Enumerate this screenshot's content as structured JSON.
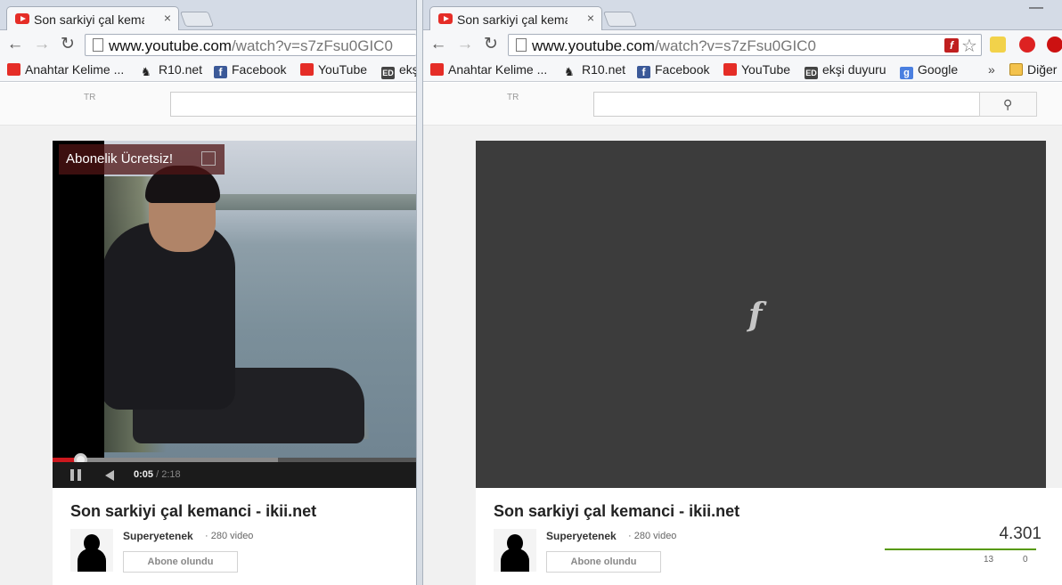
{
  "tab": {
    "title": "Son sarkiyi çal keman",
    "close": "×"
  },
  "window_controls": {
    "minimize": "—"
  },
  "address": {
    "host": "www.youtube.com",
    "path": "/watch?v=s7zFsu0GIC0"
  },
  "nav": {
    "back": "←",
    "forward": "→",
    "reload": "↻"
  },
  "bookmarks": [
    {
      "label": "Anahtar Kelime ...",
      "icon": "youtube-icon"
    },
    {
      "label": "R10.net",
      "icon": "r10-icon"
    },
    {
      "label": "Facebook",
      "icon": "facebook-icon"
    },
    {
      "label": "YouTube",
      "icon": "youtube-icon"
    },
    {
      "label": "ekşi duyuru",
      "icon": "eksi-icon"
    },
    {
      "label": "Google",
      "icon": "google-icon"
    }
  ],
  "bookmarks_left_truncated": "ekşi",
  "bookmarks_more": "»",
  "bookmarks_other": "Diğer",
  "youtube": {
    "country": "TR",
    "search_icon": "⚲"
  },
  "player_left": {
    "ad_text": "Abonelik Ücretsiz!",
    "time_current": "0:05",
    "time_sep": " / ",
    "time_total": "2:18",
    "progress_played": 0.075,
    "progress_buffered": 0.62
  },
  "player_right": {
    "flash_glyph": "f"
  },
  "video": {
    "title": "Son sarkiyi çal kemanci - ikii.net",
    "channel": "Superyetenek",
    "channel_meta": "· 280 video",
    "subscribe_label": "Abone olundu",
    "views": "4.301",
    "likes": "13",
    "dislikes": "0",
    "like_ratio": 1.0
  },
  "colors": {
    "yt_red": "#e52d27",
    "progress_red": "#cc181e",
    "like_green": "#559900",
    "flash_bg": "#3c3c3c"
  }
}
